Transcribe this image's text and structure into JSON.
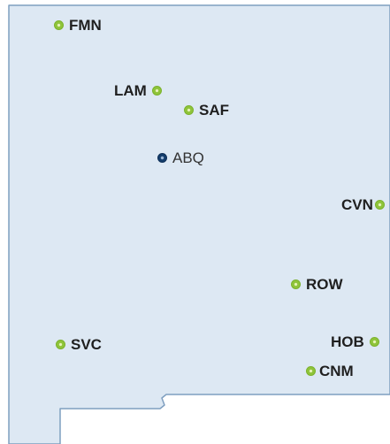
{
  "map": {
    "fill_color": "#dde8f3",
    "border_color": "#7f9fc0"
  },
  "airports": [
    {
      "code": "FMN",
      "type": "regional"
    },
    {
      "code": "LAM",
      "type": "regional"
    },
    {
      "code": "SAF",
      "type": "regional"
    },
    {
      "code": "ABQ",
      "type": "hub"
    },
    {
      "code": "CVN",
      "type": "regional"
    },
    {
      "code": "ROW",
      "type": "regional"
    },
    {
      "code": "SVC",
      "type": "regional"
    },
    {
      "code": "HOB",
      "type": "regional"
    },
    {
      "code": "CNM",
      "type": "regional"
    }
  ],
  "marker_colors": {
    "regional": "#8fc43a",
    "hub": "#133c6b"
  }
}
